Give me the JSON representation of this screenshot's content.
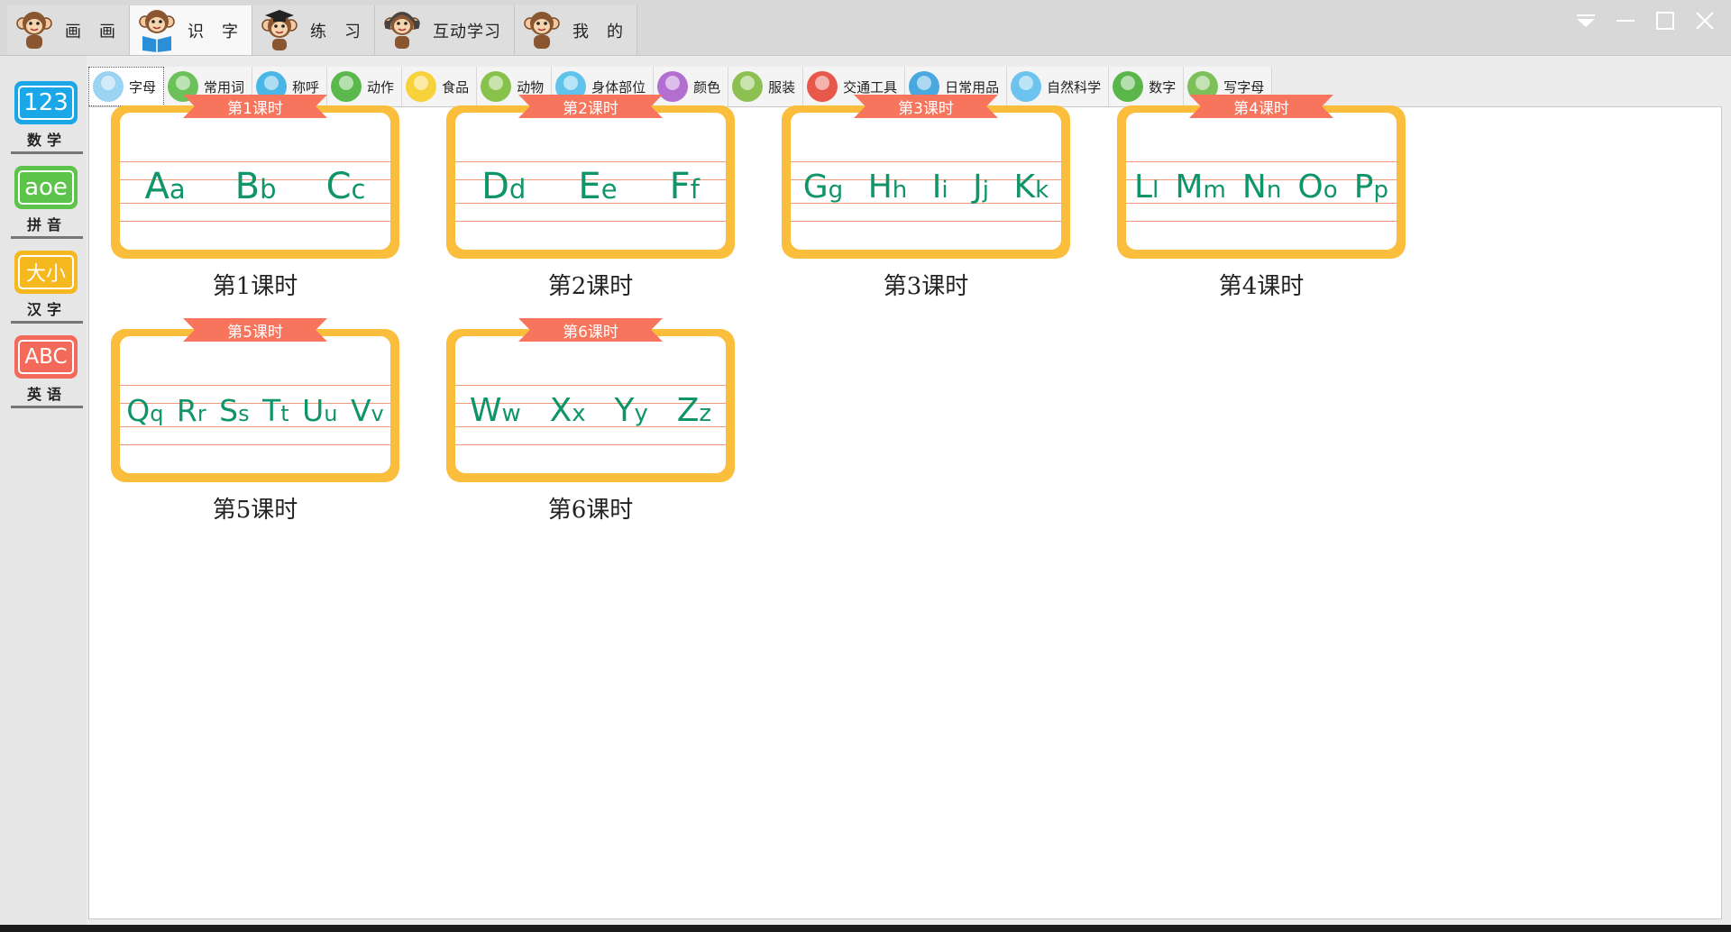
{
  "main_tabs": [
    {
      "label": "画　画",
      "active": false
    },
    {
      "label": "识　字",
      "active": true
    },
    {
      "label": "练　习",
      "active": false
    },
    {
      "label": "互动学习",
      "active": false
    },
    {
      "label": "我　的",
      "active": false
    }
  ],
  "sidebar": {
    "items": [
      {
        "icon_text": "123",
        "label": "数学",
        "color": "#1aa7e8"
      },
      {
        "icon_text": "aoe",
        "label": "拼音",
        "color": "#5cc44a"
      },
      {
        "icon_text": "大小",
        "label": "汉字",
        "color": "#f5b81f"
      },
      {
        "icon_text": "ABC",
        "label": "英语",
        "color": "#f36a5a"
      }
    ]
  },
  "categories": [
    {
      "label": "字母",
      "icon": "abc-icon",
      "color": "#9bd3f3",
      "active": true
    },
    {
      "label": "常用词",
      "icon": "child-reading-icon",
      "color": "#6cc25a"
    },
    {
      "label": "称呼",
      "icon": "family-icon",
      "color": "#49b6e6"
    },
    {
      "label": "动作",
      "icon": "running-child-icon",
      "color": "#5bb84c"
    },
    {
      "label": "食品",
      "icon": "banana-icon",
      "color": "#f7d23a"
    },
    {
      "label": "动物",
      "icon": "monkey-icon",
      "color": "#88c24b"
    },
    {
      "label": "身体部位",
      "icon": "hand-icon",
      "color": "#5fc3ec"
    },
    {
      "label": "颜色",
      "icon": "paint-icon",
      "color": "#b36fd0"
    },
    {
      "label": "服装",
      "icon": "clothes-icon",
      "color": "#8cc152"
    },
    {
      "label": "交通工具",
      "icon": "car-icon",
      "color": "#e8574b"
    },
    {
      "label": "日常用品",
      "icon": "toothbrush-icon",
      "color": "#4aa8e0"
    },
    {
      "label": "自然科学",
      "icon": "cloud-icon",
      "color": "#6cc3ee"
    },
    {
      "label": "数字",
      "icon": "number-icon",
      "color": "#5ab54b"
    },
    {
      "label": "写字母",
      "icon": "pencil-icon",
      "color": "#7cc05a"
    }
  ],
  "lessons": [
    {
      "ribbon": "第1课时",
      "label": "第1课时",
      "pairs": [
        [
          "A",
          "a"
        ],
        [
          "B",
          "b"
        ],
        [
          "C",
          "c"
        ]
      ]
    },
    {
      "ribbon": "第2课时",
      "label": "第2课时",
      "pairs": [
        [
          "D",
          "d"
        ],
        [
          "E",
          "e"
        ],
        [
          "F",
          "f"
        ]
      ]
    },
    {
      "ribbon": "第3课时",
      "label": "第3课时",
      "pairs": [
        [
          "G",
          "g"
        ],
        [
          "H",
          "h"
        ],
        [
          "I",
          "i"
        ],
        [
          "J",
          "j"
        ],
        [
          "K",
          "k"
        ]
      ]
    },
    {
      "ribbon": "第4课时",
      "label": "第4课时",
      "pairs": [
        [
          "L",
          "l"
        ],
        [
          "M",
          "m"
        ],
        [
          "N",
          "n"
        ],
        [
          "O",
          "o"
        ],
        [
          "P",
          "p"
        ]
      ]
    },
    {
      "ribbon": "第5课时",
      "label": "第5课时",
      "pairs": [
        [
          "Q",
          "q"
        ],
        [
          "R",
          "r"
        ],
        [
          "S",
          "s"
        ],
        [
          "T",
          "t"
        ],
        [
          "U",
          "u"
        ],
        [
          "V",
          "v"
        ]
      ]
    },
    {
      "ribbon": "第6课时",
      "label": "第6课时",
      "pairs": [
        [
          "W",
          "w"
        ],
        [
          "X",
          "x"
        ],
        [
          "Y",
          "y"
        ],
        [
          "Z",
          "z"
        ]
      ]
    }
  ],
  "colors": {
    "card_border": "#fbbd3c",
    "ribbon": "#f7745d",
    "letters": "#10956a",
    "guide_lines": "#f29a7c"
  }
}
